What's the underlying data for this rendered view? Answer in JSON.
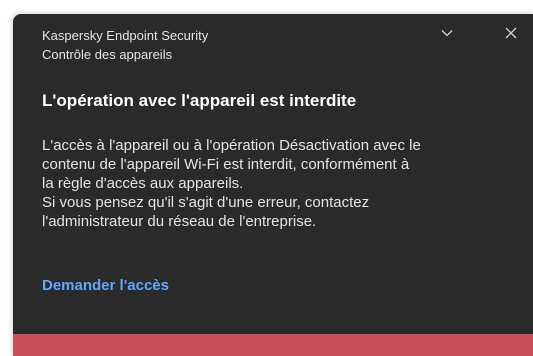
{
  "notification": {
    "app_name": "Kaspersky Endpoint Security",
    "component": "Contrôle des appareils",
    "title": "L'opération avec l'appareil est interdite",
    "message_lines": [
      "L'accès à l'appareil ou à l'opération Désactivation avec le",
      "contenu de l'appareil Wi-Fi est interdit, conformément à",
      "la règle d'accès aux appareils.",
      "Si vous pensez qu'il s'agit d'une erreur, contactez",
      "l'administrateur du réseau de l'entreprise."
    ],
    "action_link": "Demander l'accès",
    "controls": {
      "collapse_icon": "chevron-down-icon",
      "close_icon": "close-icon"
    }
  },
  "colors": {
    "background": "#2a2a2a",
    "link": "#62a8ff",
    "severity_bar": "#c8505a"
  }
}
